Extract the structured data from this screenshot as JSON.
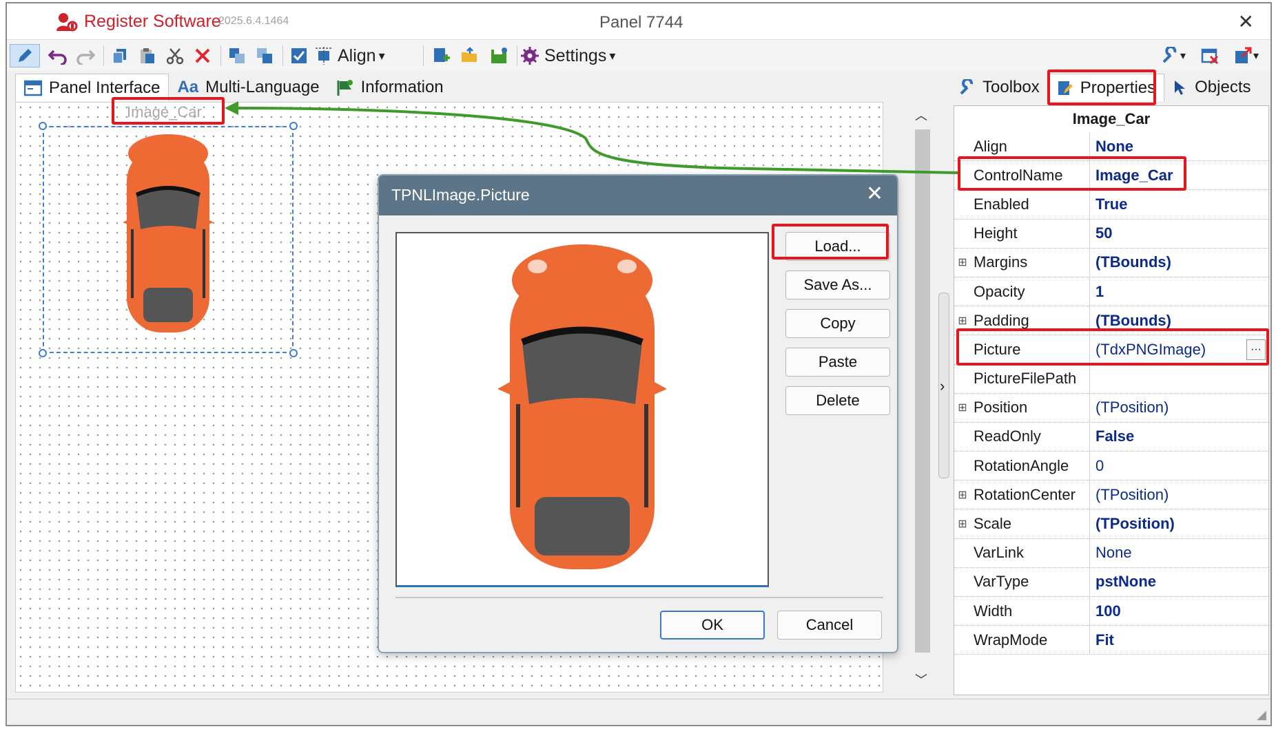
{
  "window": {
    "app_title": "Register Software",
    "version": "2025.6.4.1464",
    "panel_title": "Panel 7744",
    "close_glyph": "✕"
  },
  "toolbar": {
    "align_label": "Align",
    "settings_label": "Settings",
    "dropdown_glyph": "▾"
  },
  "tabs_left": [
    {
      "label": "Panel Interface",
      "icon": "panel-icon"
    },
    {
      "label": "Multi-Language",
      "icon_text": "Aa"
    },
    {
      "label": "Information",
      "icon": "info-flag-icon"
    }
  ],
  "tabs_right": [
    {
      "label": "Toolbox",
      "icon": "wrench-icon"
    },
    {
      "label": "Properties",
      "icon": "pencil-icon"
    },
    {
      "label": "Objects",
      "icon": "cursor-icon"
    }
  ],
  "design": {
    "selected_label": "Image_Car"
  },
  "dialog": {
    "title": "TPNLImage.Picture",
    "buttons": {
      "load": "Load...",
      "save_as": "Save As...",
      "copy": "Copy",
      "paste": "Paste",
      "delete": "Delete",
      "ok": "OK",
      "cancel": "Cancel"
    }
  },
  "properties": {
    "header": "Image_Car",
    "rows": [
      {
        "name": "Align",
        "value": "None",
        "bold": true,
        "expand": false
      },
      {
        "name": "ControlName",
        "value": "Image_Car",
        "bold": true,
        "expand": false
      },
      {
        "name": "Enabled",
        "value": "True",
        "bold": true,
        "expand": false
      },
      {
        "name": "Height",
        "value": "50",
        "bold": true,
        "expand": false
      },
      {
        "name": "Margins",
        "value": "(TBounds)",
        "bold": true,
        "expand": true
      },
      {
        "name": "Opacity",
        "value": "1",
        "bold": true,
        "expand": false
      },
      {
        "name": "Padding",
        "value": "(TBounds)",
        "bold": true,
        "expand": true
      },
      {
        "name": "Picture",
        "value": "(TdxPNGImage)",
        "bold": false,
        "expand": false
      },
      {
        "name": "PictureFilePath",
        "value": "",
        "bold": false,
        "expand": false
      },
      {
        "name": "Position",
        "value": "(TPosition)",
        "bold": false,
        "expand": true
      },
      {
        "name": "ReadOnly",
        "value": "False",
        "bold": true,
        "expand": false
      },
      {
        "name": "RotationAngle",
        "value": "0",
        "bold": false,
        "expand": false
      },
      {
        "name": "RotationCenter",
        "value": "(TPosition)",
        "bold": false,
        "expand": true
      },
      {
        "name": "Scale",
        "value": "(TPosition)",
        "bold": true,
        "expand": true
      },
      {
        "name": "VarLink",
        "value": "None",
        "bold": false,
        "expand": false
      },
      {
        "name": "VarType",
        "value": "pstNone",
        "bold": true,
        "expand": false
      },
      {
        "name": "Width",
        "value": "100",
        "bold": true,
        "expand": false
      },
      {
        "name": "WrapMode",
        "value": "Fit",
        "bold": true,
        "expand": false
      }
    ],
    "expand_glyph": "⊞",
    "ellipsis": "···"
  },
  "colors": {
    "highlight": "#e8141e",
    "arrow": "#3f9a2a",
    "car_body": "#ee6a34",
    "selection": "#3e7dd6"
  }
}
